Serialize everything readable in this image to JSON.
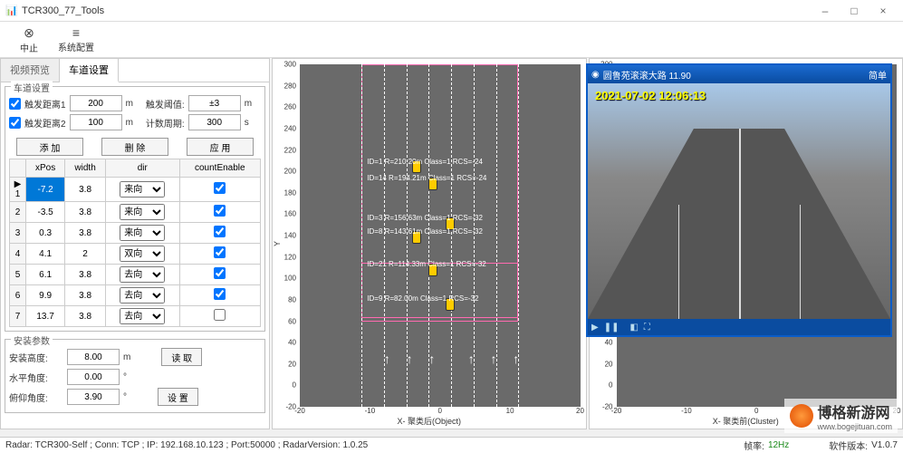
{
  "window": {
    "title": "TCR300_77_Tools"
  },
  "win_btns": {
    "min": "–",
    "max": "□",
    "close": "×"
  },
  "toolbar": {
    "stop": "中止",
    "config": "系统配置",
    "stop_glyph": "⊗",
    "config_glyph": "≡"
  },
  "tabs": {
    "video": "视频预览",
    "lane": "车道设置"
  },
  "lane_cfg": {
    "legend": "车道设置",
    "trig_dist1_lbl": "触发距离1",
    "trig_dist1": "200",
    "unit_m": "m",
    "trig_thresh_lbl": "触发阈值:",
    "trig_thresh": "±3",
    "trig_dist2_lbl": "触发距离2",
    "trig_dist2": "100",
    "count_period_lbl": "计数周期:",
    "count_period": "300",
    "unit_s": "s",
    "btn_add": "添 加",
    "btn_del": "删 除",
    "btn_apply": "应 用",
    "cols": {
      "xpos": "xPos",
      "width": "width",
      "dir": "dir",
      "cnt": "countEnable"
    },
    "rows": [
      {
        "n": "1",
        "xpos": "-7.2",
        "width": "3.8",
        "dir": "来向",
        "cnt": true,
        "sel": true
      },
      {
        "n": "2",
        "xpos": "-3.5",
        "width": "3.8",
        "dir": "来向",
        "cnt": true
      },
      {
        "n": "3",
        "xpos": "0.3",
        "width": "3.8",
        "dir": "来向",
        "cnt": true
      },
      {
        "n": "4",
        "xpos": "4.1",
        "width": "2",
        "dir": "双向",
        "cnt": true
      },
      {
        "n": "5",
        "xpos": "6.1",
        "width": "3.8",
        "dir": "去向",
        "cnt": true
      },
      {
        "n": "6",
        "xpos": "9.9",
        "width": "3.8",
        "dir": "去向",
        "cnt": true
      },
      {
        "n": "7",
        "xpos": "13.7",
        "width": "3.8",
        "dir": "去向",
        "cnt": false
      }
    ]
  },
  "install": {
    "legend": "安装参数",
    "height_lbl": "安装高度:",
    "height": "8.00",
    "unit_m": "m",
    "hangle_lbl": "水平角度:",
    "hangle": "0.00",
    "unit_deg": "°",
    "vangle_lbl": "俯仰角度:",
    "vangle": "3.90",
    "btn_read": "读 取",
    "btn_set": "设 置"
  },
  "plot1": {
    "xlabel": "X- 聚类后(Object)",
    "ylabel": "Y",
    "yticks": [
      "300",
      "280",
      "260",
      "240",
      "220",
      "200",
      "180",
      "160",
      "140",
      "120",
      "100",
      "80",
      "60",
      "40",
      "20",
      "0",
      "-20"
    ],
    "xticks": [
      "-20",
      "-10",
      "0",
      "10",
      "20"
    ],
    "detections": [
      "ID=1 R=210.20m Class=1 RCS=-24",
      "ID=14 R=194.21m Class=1 RCS=-24",
      "ID=3 R=156.63m Class=1 RCS=-32",
      "ID=8 R=143.61m Class=1 RCS=-32",
      "ID=21 R=114.33m Class=1 RCS=-32",
      "ID=9 R=82.00m Class=1 RCS=-32"
    ]
  },
  "plot2": {
    "xlabel": "X- 聚类前(Cluster)",
    "ylabel": "Y"
  },
  "video": {
    "title": "圆鲁苑滚滚大路 11.90",
    "menu": "简单",
    "timestamp": "2021-07-02 12:06:13",
    "play": "▶",
    "pause": "❚❚"
  },
  "status": {
    "radar": "Radar: TCR300-Self ;  Conn: TCP ;  IP: 192.168.10.123 ;  Port:50000 ;  RadarVersion: 1.0.25",
    "fps_lbl": "帧率:",
    "fps": "12Hz",
    "ver_lbl": "软件版本:",
    "ver": "V1.0.7"
  },
  "watermark": {
    "line1": "博格新游网",
    "line2": "www.bogejituan.com"
  },
  "chart_data": {
    "type": "scatter",
    "title": "X- 聚类后(Object)",
    "xlabel": "X",
    "ylabel": "Y",
    "xlim": [
      -20,
      20
    ],
    "ylim": [
      -20,
      300
    ],
    "series": [
      {
        "name": "detections",
        "points": [
          {
            "id": 1,
            "r": 210.2,
            "class": 1,
            "rcs": -24,
            "y": 210
          },
          {
            "id": 14,
            "r": 194.21,
            "class": 1,
            "rcs": -24,
            "y": 194
          },
          {
            "id": 3,
            "r": 156.63,
            "class": 1,
            "rcs": -32,
            "y": 157
          },
          {
            "id": 8,
            "r": 143.61,
            "class": 1,
            "rcs": -32,
            "y": 144
          },
          {
            "id": 21,
            "r": 114.33,
            "class": 1,
            "rcs": -32,
            "y": 114
          },
          {
            "id": 9,
            "r": 82.0,
            "class": 1,
            "rcs": -32,
            "y": 82
          }
        ]
      }
    ],
    "lanes": [
      {
        "xpos": -7.2,
        "width": 3.8,
        "dir": "来向"
      },
      {
        "xpos": -3.5,
        "width": 3.8,
        "dir": "来向"
      },
      {
        "xpos": 0.3,
        "width": 3.8,
        "dir": "来向"
      },
      {
        "xpos": 4.1,
        "width": 2,
        "dir": "双向"
      },
      {
        "xpos": 6.1,
        "width": 3.8,
        "dir": "去向"
      },
      {
        "xpos": 9.9,
        "width": 3.8,
        "dir": "去向"
      },
      {
        "xpos": 13.7,
        "width": 3.8,
        "dir": "去向"
      }
    ]
  }
}
